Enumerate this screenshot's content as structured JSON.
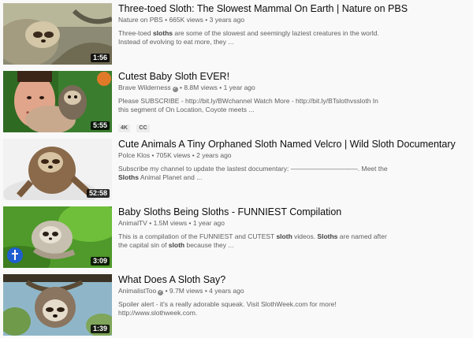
{
  "results": [
    {
      "title": "Three-toed Sloth: The Slowest Mammal On Earth | Nature on PBS",
      "channel": "Nature on PBS",
      "verified": false,
      "views": "665K views",
      "age": "3 years ago",
      "duration": "1:56",
      "description": [
        {
          "t": "Three-toed "
        },
        {
          "t": "sloths",
          "b": true
        },
        {
          "t": " are some of the slowest and seemingly laziest creatures in the world. Instead of evolving to eat more, they ..."
        }
      ],
      "badges": []
    },
    {
      "title": "Cutest Baby Sloth EVER!",
      "channel": "Brave Wilderness",
      "verified": true,
      "views": "8.8M views",
      "age": "1 year ago",
      "duration": "5:55",
      "description": [
        {
          "t": "Please SUBSCRIBE - http://bit.ly/BWchannel Watch More - http://bit.ly/BTslothvssloth In this segment of On Location, Coyote meets ..."
        }
      ],
      "badges": [
        "4K",
        "CC"
      ]
    },
    {
      "title": "Cute Animals A Tiny Orphaned Sloth Named Velcro | Wild Sloth Documentary",
      "channel": "Polce Klos",
      "verified": false,
      "views": "705K views",
      "age": "2 years ago",
      "duration": "52:58",
      "description": [
        {
          "t": "Subscribe my channel to update the lastest documentary: ——————————. Meet the "
        },
        {
          "t": "Sloths",
          "b": true
        },
        {
          "t": " Animal Planet and ..."
        }
      ],
      "badges": []
    },
    {
      "title": "Baby Sloths Being Sloths - FUNNIEST Compilation",
      "channel": "AnimalTV",
      "verified": false,
      "views": "1.5M views",
      "age": "1 year ago",
      "duration": "3:09",
      "description": [
        {
          "t": "This is a compilation of the FUNNIEST and CUTEST "
        },
        {
          "t": "sloth",
          "b": true
        },
        {
          "t": " videos. "
        },
        {
          "t": "Sloths",
          "b": true
        },
        {
          "t": " are named after the capital sin of "
        },
        {
          "t": "sloth",
          "b": true
        },
        {
          "t": " because they ..."
        }
      ],
      "badges": []
    },
    {
      "title": "What Does A Sloth Say?",
      "channel": "AnimalistToo",
      "verified": true,
      "views": "9.7M views",
      "age": "4 years ago",
      "duration": "1:39",
      "description": [
        {
          "t": "Spoiler alert - it's a really adorable squeak. Visit SlothWeek.com for more! http://www.slothweek.com."
        }
      ],
      "badges": []
    }
  ],
  "ui": {
    "separator": "•",
    "verified_glyph": "✓"
  }
}
